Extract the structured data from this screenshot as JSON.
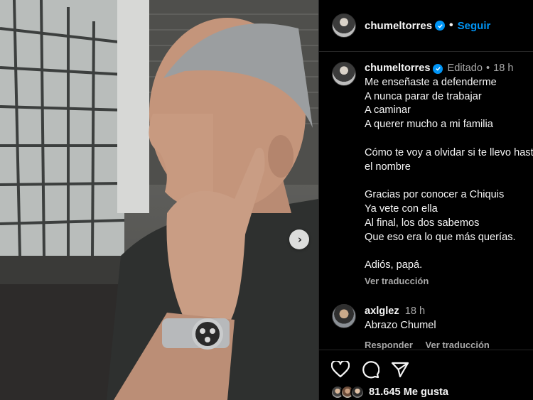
{
  "post": {
    "author": "chumeltorres",
    "follow_label": "Seguir",
    "dot": "•",
    "caption": {
      "author": "chumeltorres",
      "edited_label": "Editado",
      "separator": "•",
      "age": "18 h",
      "lines": [
        "Me enseñaste a defenderme",
        "A nunca parar de trabajar",
        "A caminar",
        "A querer mucho a mi familia",
        "",
        "Cómo te voy a olvidar si te llevo hasta en",
        "el nombre",
        "",
        "Gracias por conocer a Chiquis",
        "Ya vete con ella",
        "Al final, los dos sabemos",
        "Que eso era lo que más querías.",
        "",
        "Adiós, papá."
      ],
      "translate_label": "Ver traducción"
    },
    "comment": {
      "author": "axlglez",
      "age": "18 h",
      "text": "Abrazo Chumel",
      "reply_label": "Responder",
      "translate_label": "Ver traducción"
    },
    "actions": {
      "like_icon": "heart-icon",
      "comment_icon": "comment-icon",
      "share_icon": "send-icon"
    },
    "likes_text": "81.645 Me gusta",
    "carousel_next_icon": "chevron-right-icon"
  },
  "colors": {
    "background": "#000000",
    "text": "#f5f5f5",
    "muted": "#a8a8a8",
    "link_blue": "#0095f6",
    "divider": "#262626"
  }
}
